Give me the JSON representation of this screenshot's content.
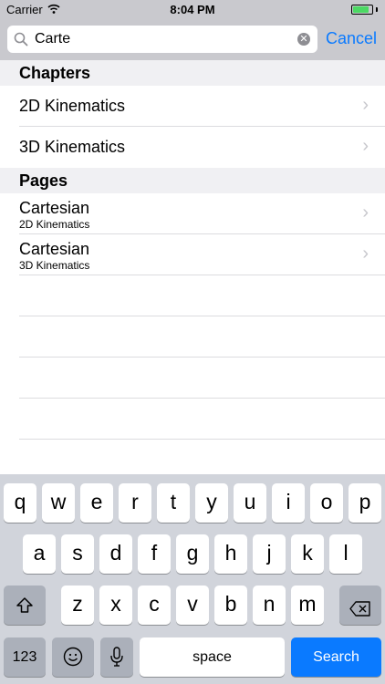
{
  "status_bar": {
    "carrier": "Carrier",
    "time": "8:04 PM",
    "battery_level": 0.85
  },
  "search": {
    "query": "Carte",
    "cancel_label": "Cancel"
  },
  "sections": [
    {
      "header": "Chapters",
      "rows": [
        {
          "title": "2D Kinematics"
        },
        {
          "title": "3D Kinematics"
        }
      ]
    },
    {
      "header": "Pages",
      "rows": [
        {
          "title": "Cartesian",
          "subtitle": "2D Kinematics"
        },
        {
          "title": "Cartesian",
          "subtitle": "3D Kinematics"
        }
      ]
    }
  ],
  "keyboard": {
    "row1": [
      "q",
      "w",
      "e",
      "r",
      "t",
      "y",
      "u",
      "i",
      "o",
      "p"
    ],
    "row2": [
      "a",
      "s",
      "d",
      "f",
      "g",
      "h",
      "j",
      "k",
      "l"
    ],
    "row3": [
      "z",
      "x",
      "c",
      "v",
      "b",
      "n",
      "m"
    ],
    "numbers_label": "123",
    "space_label": "space",
    "search_label": "Search"
  },
  "colors": {
    "accent": "#0a7aff",
    "battery": "#4cd964"
  }
}
